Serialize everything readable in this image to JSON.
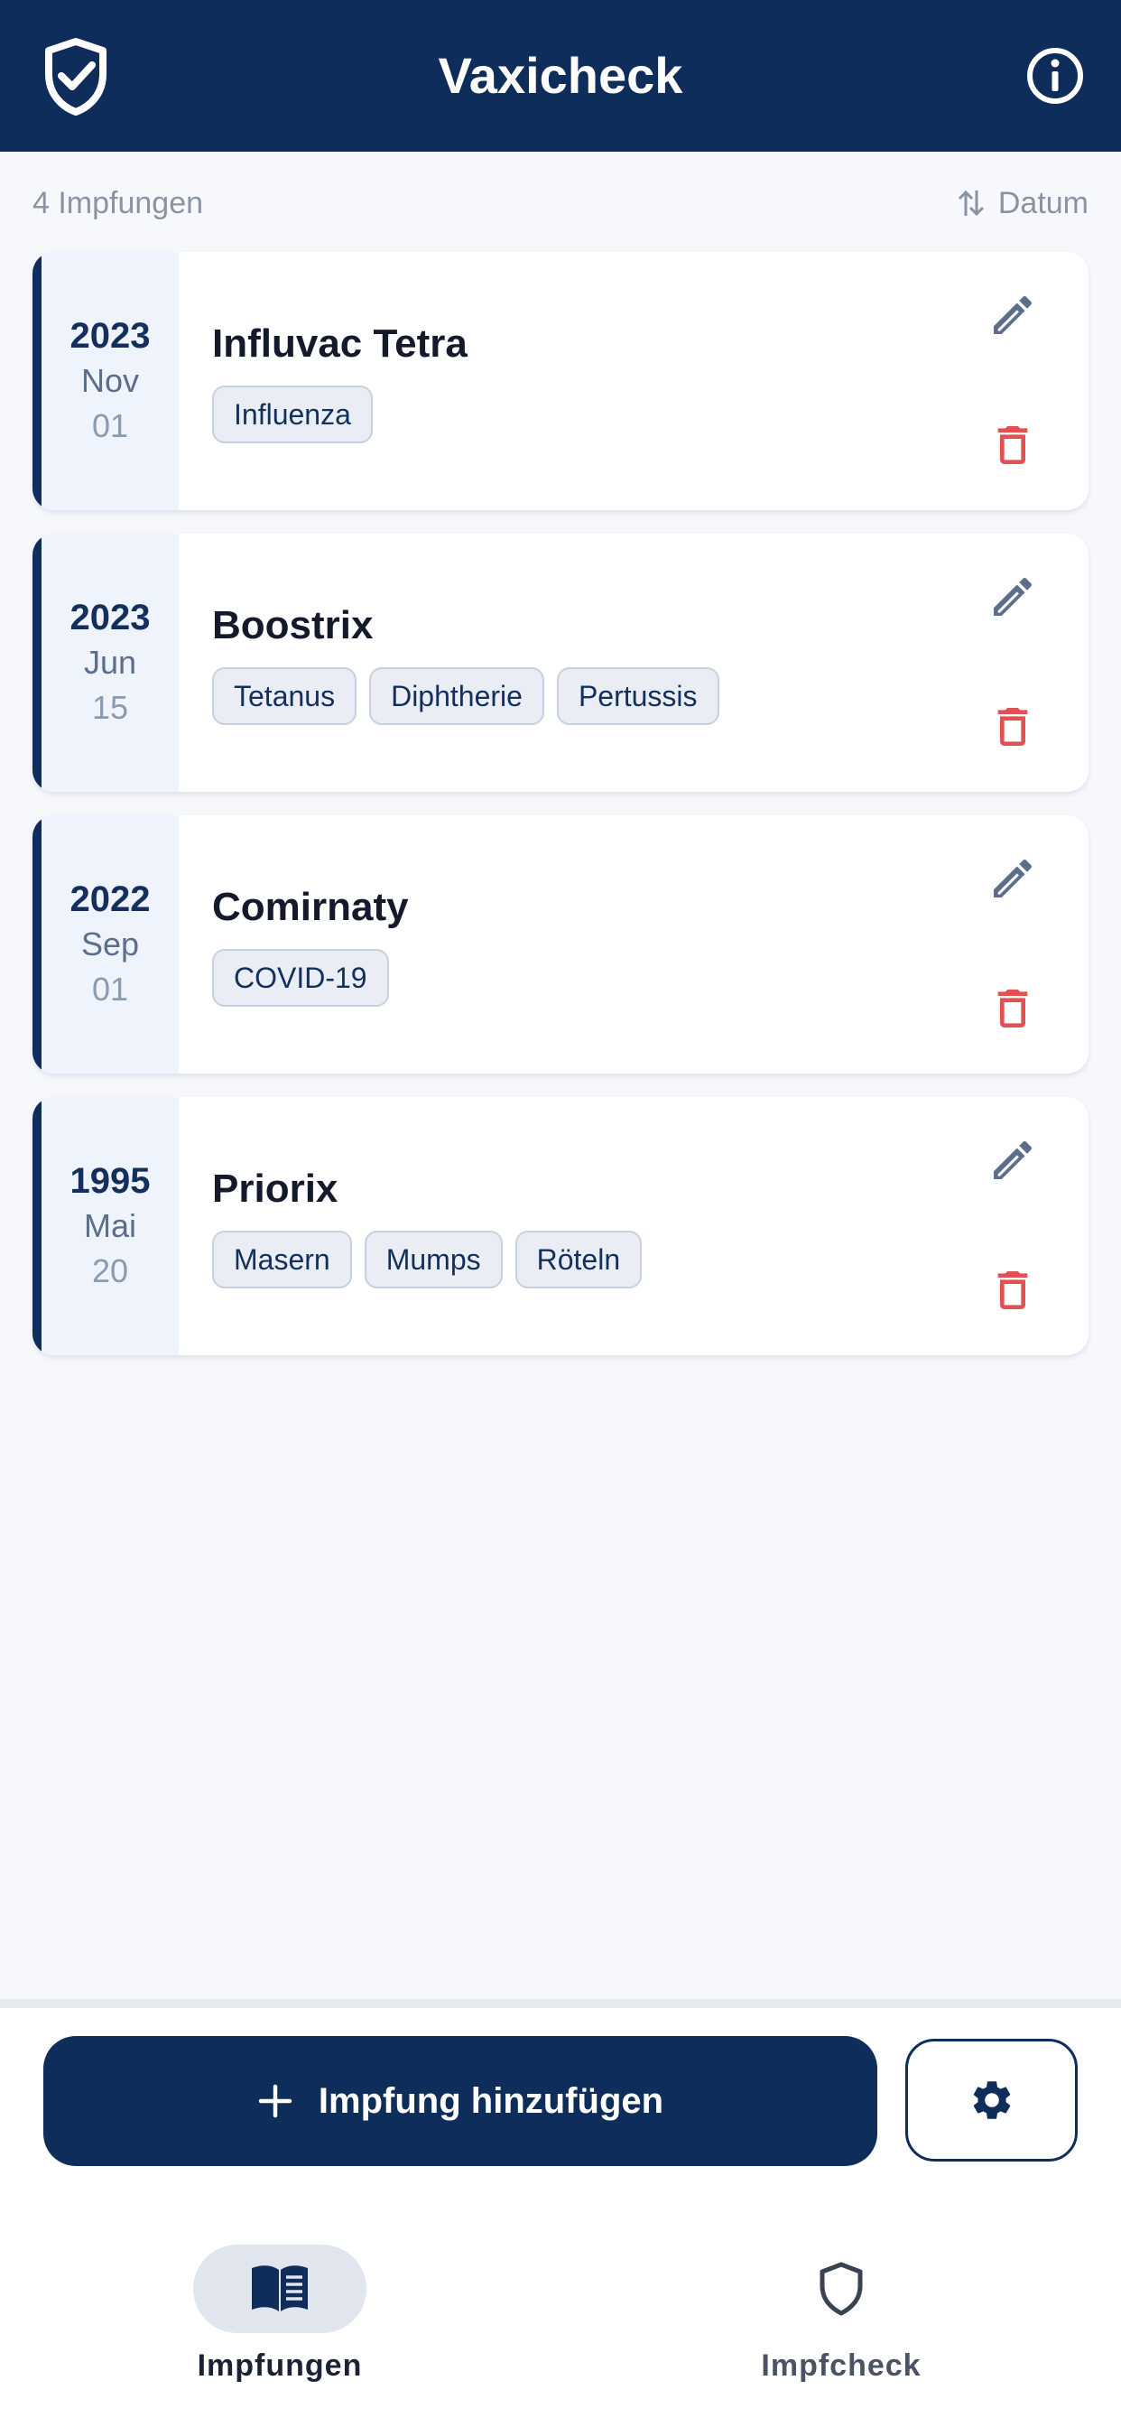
{
  "header": {
    "title": "Vaxicheck",
    "logo_icon": "shield-check-icon",
    "info_icon": "info-circle-icon"
  },
  "summary": {
    "count_label": "4 Impfungen",
    "sort_label": "Datum",
    "sort_icon": "sort-arrows-icon"
  },
  "vaccinations": [
    {
      "year": "2023",
      "month": "Nov",
      "day": "01",
      "name": "Influvac Tetra",
      "tags": [
        "Influenza"
      ]
    },
    {
      "year": "2023",
      "month": "Jun",
      "day": "15",
      "name": "Boostrix",
      "tags": [
        "Tetanus",
        "Diphtherie",
        "Pertussis"
      ]
    },
    {
      "year": "2022",
      "month": "Sep",
      "day": "01",
      "name": "Comirnaty",
      "tags": [
        "COVID-19"
      ]
    },
    {
      "year": "1995",
      "month": "Mai",
      "day": "20",
      "name": "Priorix",
      "tags": [
        "Masern",
        "Mumps",
        "Röteln"
      ]
    }
  ],
  "actions": {
    "add_label": "Impfung hinzufügen",
    "add_icon": "plus-icon",
    "settings_icon": "gear-icon"
  },
  "nav": {
    "items": [
      {
        "label": "Impfungen",
        "icon": "book-icon",
        "active": true
      },
      {
        "label": "Impfcheck",
        "icon": "shield-icon",
        "active": false
      }
    ]
  },
  "colors": {
    "primary": "#0f2d5a",
    "delete": "#e05252",
    "edit": "#5b6e8c",
    "background": "#f6f8fc"
  }
}
